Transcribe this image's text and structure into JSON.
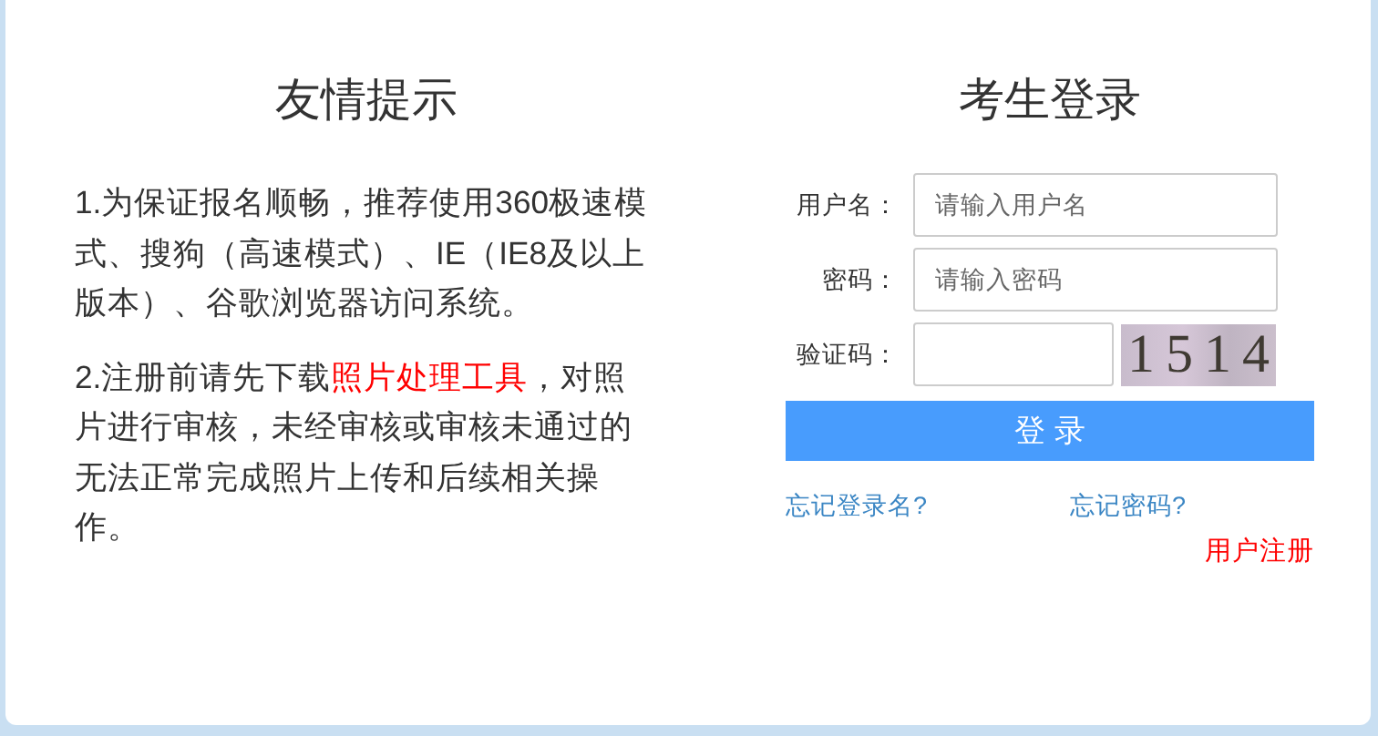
{
  "tips": {
    "title": "友情提示",
    "paragraphs": [
      {
        "text": "1.为保证报名顺畅，推荐使用360极速模式、搜狗（高速模式）、IE（IE8及以上版本）、谷歌浏览器访问系统。"
      },
      {
        "text": "2.注册前请先下载",
        "link": "照片处理工具",
        "text_after": "，对照片进行审核，未经审核或审核未通过的无法正常完成照片上传和后续相关操作。"
      }
    ]
  },
  "login": {
    "title": "考生登录",
    "fields": [
      {
        "label": "用户名：",
        "placeholder": "请输入用户名"
      },
      {
        "label": "密码：",
        "placeholder": "请输入密码"
      }
    ],
    "captcha": {
      "label": "验证码：",
      "code": "1514"
    },
    "button": "登 录",
    "links": [
      {
        "label": "忘记登录名?",
        "kind": "help"
      },
      {
        "label": "忘记密码?",
        "kind": "help"
      },
      {
        "label": "用户注册",
        "kind": "register"
      }
    ]
  }
}
